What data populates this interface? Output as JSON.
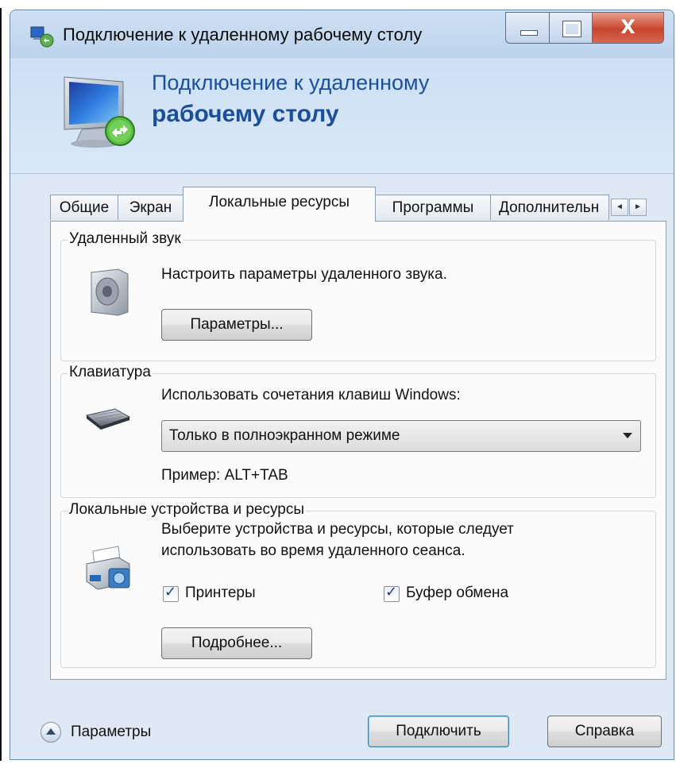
{
  "window": {
    "title": "Подключение к удаленному рабочему столу",
    "controls": {
      "minimize_icon": "minimize-icon",
      "maximize_icon": "maximize-icon",
      "close_icon": "close-icon",
      "close_glyph": "X"
    }
  },
  "header": {
    "title_line1": "Подключение к удаленному",
    "title_line2": "рабочему столу",
    "icon": "remote-desktop-monitor-icon"
  },
  "tabs": [
    {
      "label": "Общие",
      "active": false
    },
    {
      "label": "Экран",
      "active": false
    },
    {
      "label": "Локальные ресурсы",
      "active": true
    },
    {
      "label": "Программы",
      "active": false
    },
    {
      "label": "Дополнительн",
      "active": false
    }
  ],
  "tab_scroll": {
    "left": "◄",
    "right": "►"
  },
  "remote_audio": {
    "legend": "Удаленный звук",
    "description": "Настроить параметры удаленного звука.",
    "button_label": "Параметры...",
    "button_hotkey": "П"
  },
  "keyboard": {
    "legend": "Клавиатура",
    "description": "Использовать сочетания клавиш Windows:",
    "selected_option": "Только в полноэкранном режиме",
    "example": "Пример: ALT+TAB"
  },
  "local_devices": {
    "legend": "Локальные устройства и ресурсы",
    "description_line1": "Выберите устройства и ресурсы, которые следует",
    "description_line2": "использовать во время удаленного сеанса.",
    "printers_label": "Принтеры",
    "printers_checked": true,
    "clipboard_label": "Буфер обмена",
    "clipboard_checked": true,
    "more_button_label": "Подробнее..."
  },
  "footer": {
    "options_label": "Параметры",
    "connect_label": "Подключить",
    "help_label": "Справка"
  },
  "colors": {
    "header_title": "#1a4f9c",
    "window_frame": "#bcd3ec",
    "close_button": "#c8452e"
  }
}
